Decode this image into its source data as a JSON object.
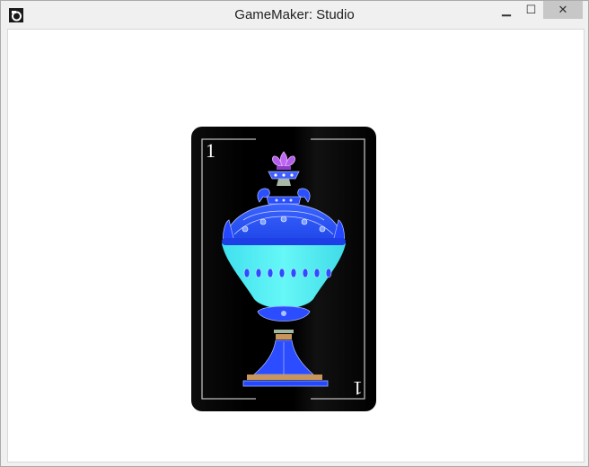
{
  "window": {
    "title": "GameMaker: Studio",
    "controls": {
      "minimize": "▁",
      "maximize": "☐",
      "close": "✕"
    }
  },
  "card": {
    "rank_top": "1",
    "rank_bottom": "1",
    "suit": "cups",
    "colors": {
      "background": "#000000",
      "frame": "#bdbdbd",
      "cup_blue": "#2f55ff",
      "cup_cyan": "#5ff5f5",
      "crown_purple": "#c067f2",
      "base_gold": "#c9955a"
    }
  }
}
